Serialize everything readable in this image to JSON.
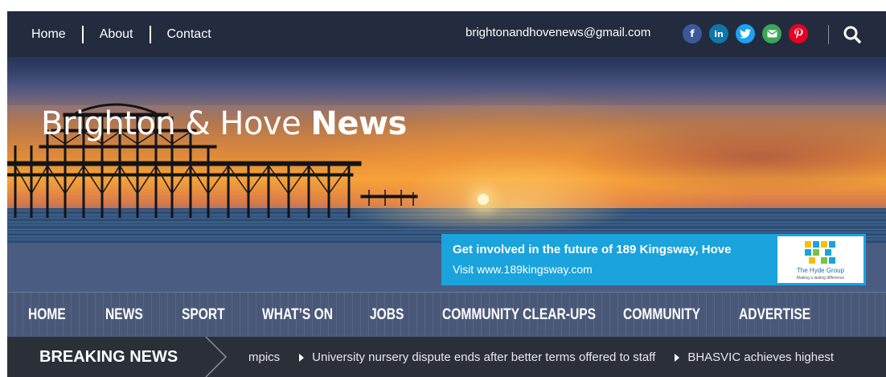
{
  "topbar": {
    "nav": [
      {
        "label": "Home"
      },
      {
        "label": "About"
      },
      {
        "label": "Contact"
      }
    ],
    "email": "brightonandhovenews@gmail.com",
    "social": [
      {
        "icon": "facebook-icon",
        "glyph": "f",
        "color": "#3b5998"
      },
      {
        "icon": "linkedin-icon",
        "glyph": "in",
        "color": "#0e76a8"
      },
      {
        "icon": "twitter-icon",
        "glyph": "t",
        "color": "#1da1f2"
      },
      {
        "icon": "email-icon",
        "glyph": "✉",
        "color": "#3aa757"
      },
      {
        "icon": "pinterest-icon",
        "glyph": "p",
        "color": "#e60023"
      }
    ],
    "search_icon": "search-icon"
  },
  "hero": {
    "title_light": "Brighton & Hove ",
    "title_bold": "News"
  },
  "ad": {
    "line1": "Get involved in the future of 189 Kingsway, Hove",
    "line2": "Visit www.189kingsway.com",
    "logo_name": "The Hyde Group",
    "logo_tag": "Making a lasting difference"
  },
  "mainnav": [
    {
      "label": "HOME"
    },
    {
      "label": "NEWS"
    },
    {
      "label": "SPORT"
    },
    {
      "label": "WHAT’S ON"
    },
    {
      "label": "JOBS"
    },
    {
      "label": "COMMUNITY CLEAR-UPS"
    },
    {
      "label": "COMMUNITY"
    },
    {
      "label": "ADVERTISE"
    }
  ],
  "breaking": {
    "label": "BREAKING NEWS",
    "items": [
      "mpics",
      "University nursery dispute ends after better terms offered to staff",
      "BHASVIC achieves highest"
    ]
  },
  "colors": {
    "topbar": "#232b3e",
    "nav": "#4a5878",
    "breaking": "#2b2f38",
    "ad": "#1aa3dc"
  }
}
